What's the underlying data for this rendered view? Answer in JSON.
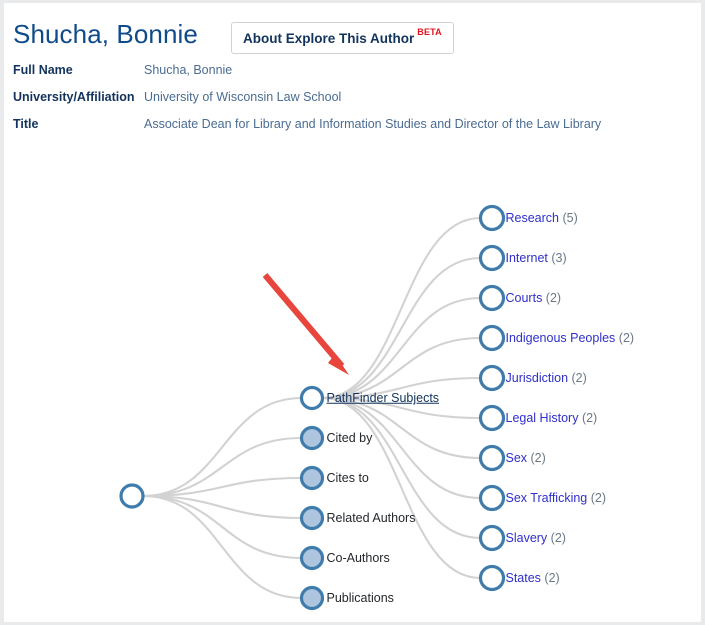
{
  "header": {
    "author_name": "Shucha, Bonnie",
    "about_button_label": "About Explore This Author",
    "beta_badge": "BETA",
    "meta": [
      {
        "label": "Full Name",
        "value": "Shucha, Bonnie"
      },
      {
        "label": "University/Affiliation",
        "value": "University of Wisconsin Law School"
      },
      {
        "label": "Title",
        "value": "Associate Dean for Library and Information Studies and Director of the Law Library"
      }
    ]
  },
  "graph": {
    "root": {
      "label": ""
    },
    "branches": [
      {
        "label": "PathFinder Subjects",
        "active": true
      },
      {
        "label": "Cited by",
        "active": false
      },
      {
        "label": "Cites to",
        "active": false
      },
      {
        "label": "Related Authors",
        "active": false
      },
      {
        "label": "Co-Authors",
        "active": false
      },
      {
        "label": "Publications",
        "active": false
      }
    ],
    "subjects": [
      {
        "label": "Research",
        "count": "(5)"
      },
      {
        "label": "Internet",
        "count": "(3)"
      },
      {
        "label": "Courts",
        "count": "(2)"
      },
      {
        "label": "Indigenous Peoples",
        "count": "(2)"
      },
      {
        "label": "Jurisdiction",
        "count": "(2)"
      },
      {
        "label": "Legal History",
        "count": "(2)"
      },
      {
        "label": "Sex",
        "count": "(2)"
      },
      {
        "label": "Sex Trafficking",
        "count": "(2)"
      },
      {
        "label": "Slavery",
        "count": "(2)"
      },
      {
        "label": "States",
        "count": "(2)"
      }
    ],
    "annotation": {
      "type": "arrow",
      "color": "#e8453c"
    }
  },
  "colors": {
    "node_stroke": "#3f7cac",
    "node_fill_open": "#ffffff",
    "node_fill_collapsed": "#aec5e0",
    "edge": "#d2d2d2",
    "link_text": "#2f2fcc",
    "heading": "#0f4a8a",
    "arrow": "#e8453c"
  }
}
